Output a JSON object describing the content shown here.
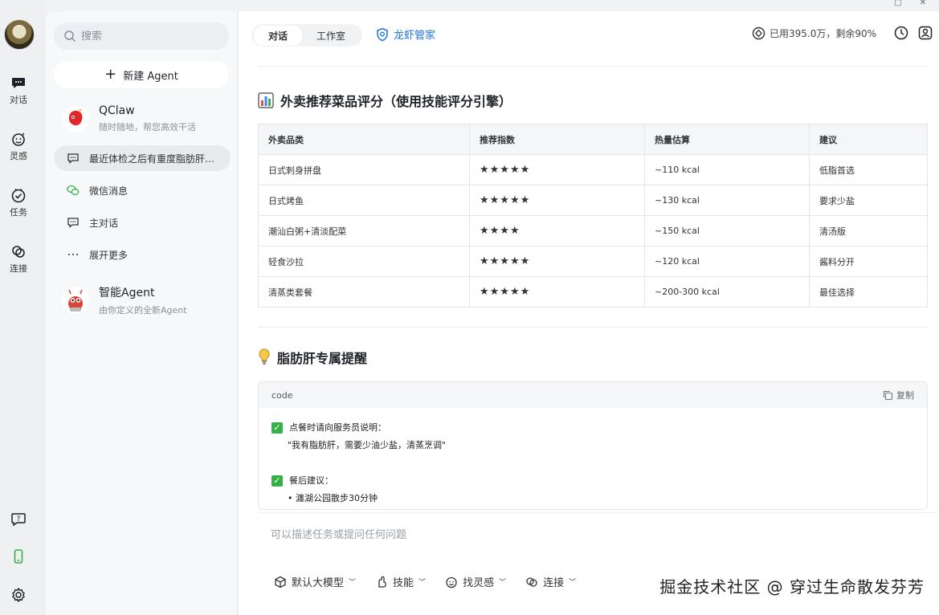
{
  "window": {
    "controls": [
      "▢",
      "✕"
    ]
  },
  "rail": {
    "items": [
      {
        "label": "对话",
        "icon": "chat-bubble-icon"
      },
      {
        "label": "灵感",
        "icon": "sparkle-face-icon"
      },
      {
        "label": "任务",
        "icon": "check-circle-icon"
      },
      {
        "label": "连接",
        "icon": "link-icon"
      }
    ],
    "bottom": [
      "help-icon",
      "phone-icon",
      "settings-icon"
    ]
  },
  "sidebar": {
    "search_placeholder": "搜索",
    "new_agent_label": "新建 Agent",
    "agents": [
      {
        "name": "QClaw",
        "subtitle": "随时随地，帮您高效干活",
        "icon": "qclaw-avatar-icon"
      },
      {
        "name": "智能Agent",
        "subtitle": "由你定义的全新Agent",
        "icon": "lobster-avatar-icon"
      }
    ],
    "items": [
      {
        "label": "最近体检之后有重度脂肪肝…",
        "icon": "chat-icon",
        "active": true
      },
      {
        "label": "微信消息",
        "icon": "wechat-icon"
      },
      {
        "label": "主对话",
        "icon": "chat-icon"
      },
      {
        "label": "展开更多",
        "icon": "more-dots-icon"
      }
    ]
  },
  "header": {
    "tabs": [
      "对话",
      "工作室"
    ],
    "active_tab": "对话",
    "brand": "龙虾管家",
    "usage": "已用395.0万，剩余90%"
  },
  "content": {
    "section1_title": "外卖推荐菜品评分（使用技能评分引擎）",
    "table": {
      "headers": [
        "外卖品类",
        "推荐指数",
        "热量估算",
        "建议"
      ],
      "rows": [
        {
          "category": "日式刺身拼盘",
          "rating": "★★★★★",
          "calories": "~110 kcal",
          "advice": "低脂首选"
        },
        {
          "category": "日式烤鱼",
          "rating": "★★★★★",
          "calories": "~130 kcal",
          "advice": "要求少盐"
        },
        {
          "category": "潮汕白粥+清淡配菜",
          "rating": "★★★★",
          "calories": "~150 kcal",
          "advice": "清汤版"
        },
        {
          "category": "轻食沙拉",
          "rating": "★★★★★",
          "calories": "~120 kcal",
          "advice": "酱料分开"
        },
        {
          "category": "清蒸类套餐",
          "rating": "★★★★★",
          "calories": "~200-300 kcal",
          "advice": "最佳选择"
        }
      ]
    },
    "section2_title": "脂肪肝专属提醒",
    "code": {
      "lang": "code",
      "copy_label": "复制",
      "line1": "点餐时请向服务员说明：",
      "line2": "\"我有脂肪肝，需要少油少盐，清蒸烹调\"",
      "line3": "餐后建议：",
      "line4": "瀍湖公园散步30分钟"
    }
  },
  "composer": {
    "placeholder": "可以描述任务或提问任何问题",
    "tools": [
      "默认大模型",
      "技能",
      "找灵感",
      "连接"
    ]
  },
  "watermark": "掘金技术社区 @ 穿过生命散发芬芳"
}
